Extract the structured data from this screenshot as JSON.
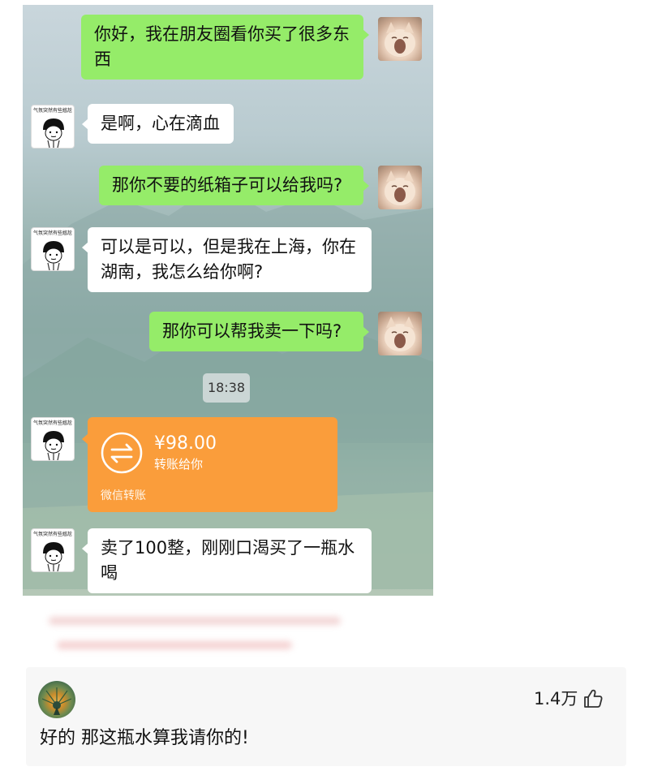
{
  "chat": {
    "messages": [
      {
        "sender": "me",
        "text": "你好，我在朋友圈看你买了很多东西"
      },
      {
        "sender": "them",
        "text": "是啊，心在滴血"
      },
      {
        "sender": "me",
        "text": "那你不要的纸箱子可以给我吗?"
      },
      {
        "sender": "them",
        "text": "可以是可以，但是我在上海，你在湖南，我怎么给你啊?"
      },
      {
        "sender": "me",
        "text": "那你可以帮我卖一下吗?"
      },
      {
        "sender": "them",
        "text": "卖了100整，刚刚口渴买了一瓶水喝"
      }
    ],
    "timestamp": "18:38",
    "transfer": {
      "amount": "¥98.00",
      "subtitle": "转账给你",
      "footer": "微信转账",
      "icon": "transfer-arrows-icon",
      "color": "#fa9d3b"
    },
    "avatar_caption": "气氛突然有些尴尬",
    "bubble_color_me": "#95ec69",
    "bubble_color_them": "#ffffff"
  },
  "comment": {
    "text": "好的 那这瓶水算我请你的!",
    "likes": "1.4万",
    "like_icon": "thumbs-up-icon"
  }
}
